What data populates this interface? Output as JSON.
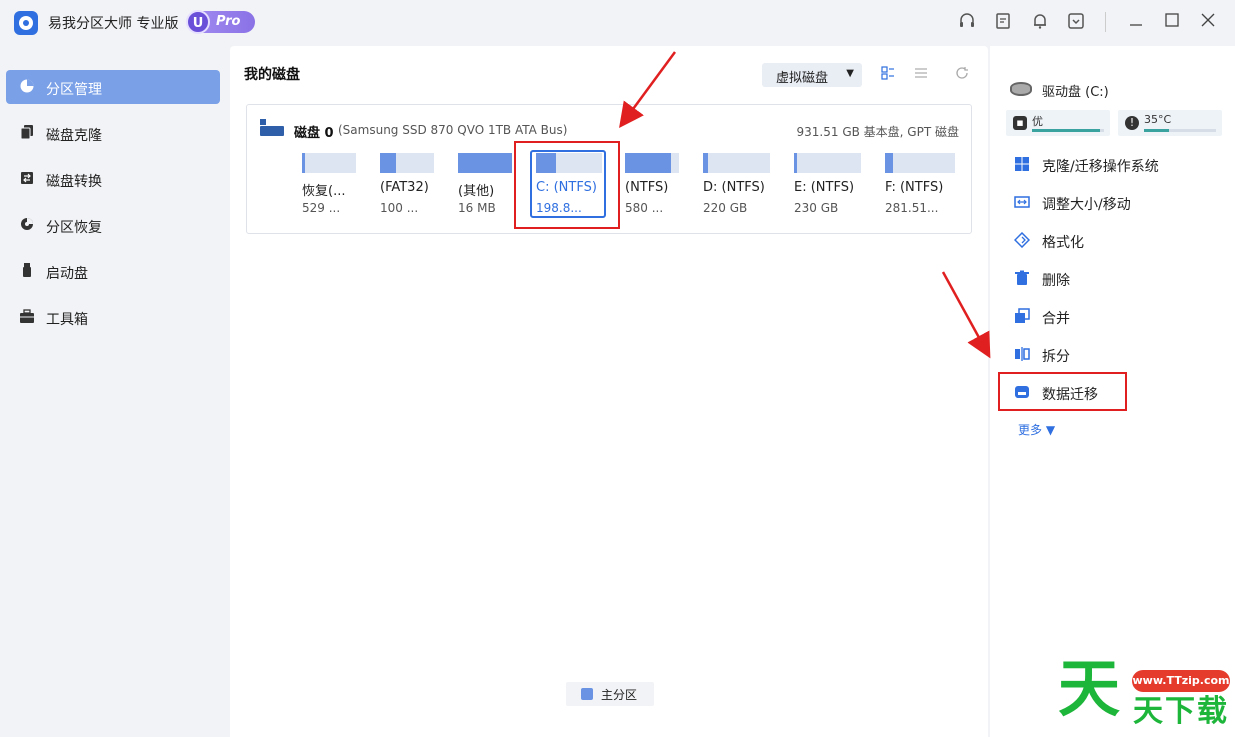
{
  "app": {
    "title": "易我分区大师 专业版",
    "badge_letter": "U",
    "badge_text": "Pro"
  },
  "titlebar_icons": [
    "headset-icon",
    "feedback-icon",
    "bell-icon",
    "download-icon"
  ],
  "sidebar": {
    "items": [
      {
        "label": "分区管理",
        "icon": "pie-chart-icon",
        "active": true
      },
      {
        "label": "磁盘克隆",
        "icon": "clone-icon",
        "active": false
      },
      {
        "label": "磁盘转换",
        "icon": "convert-icon",
        "active": false
      },
      {
        "label": "分区恢复",
        "icon": "recovery-icon",
        "active": false
      },
      {
        "label": "启动盘",
        "icon": "usb-icon",
        "active": false
      },
      {
        "label": "工具箱",
        "icon": "toolbox-icon",
        "active": false
      }
    ]
  },
  "main": {
    "title": "我的磁盘",
    "virtual_disk_label": "虚拟磁盘",
    "disk": {
      "name": "磁盘 0",
      "model": "(Samsung SSD 870 QVO 1TB ATA Bus)",
      "info": "931.51 GB 基本盘, GPT 磁盘",
      "partitions": [
        {
          "label": "恢复(...",
          "size": "529 ...",
          "fill": 0.05
        },
        {
          "label": "(FAT32)",
          "size": "100 ...",
          "fill": 0.3
        },
        {
          "label": "(其他)",
          "size": "16 MB",
          "fill": 1.0
        },
        {
          "label": "C: (NTFS)",
          "size": "198.8...",
          "fill": 0.3,
          "selected": true
        },
        {
          "label": "(NTFS)",
          "size": "580 ...",
          "fill": 0.85
        },
        {
          "label": "D: (NTFS)",
          "size": "220 GB",
          "fill": 0.08
        },
        {
          "label": "E: (NTFS)",
          "size": "230 GB",
          "fill": 0.05
        },
        {
          "label": "F: (NTFS)",
          "size": "281.51...",
          "fill": 0.12
        }
      ]
    },
    "legend": "主分区"
  },
  "right_panel": {
    "drive_label": "驱动盘 (C:)",
    "health_label": "优",
    "health_level": 0.95,
    "temp_label": "35°C",
    "temp_level": 0.35,
    "actions": [
      {
        "label": "克隆/迁移操作系统",
        "icon": "windows-icon"
      },
      {
        "label": "调整大小/移动",
        "icon": "resize-icon"
      },
      {
        "label": "格式化",
        "icon": "format-icon"
      },
      {
        "label": "删除",
        "icon": "trash-icon"
      },
      {
        "label": "合并",
        "icon": "merge-icon"
      },
      {
        "label": "拆分",
        "icon": "split-icon"
      },
      {
        "label": "数据迁移",
        "icon": "data-migrate-icon"
      }
    ],
    "more_label": "更多 ▼"
  },
  "watermark": {
    "big": "天",
    "url": "www.TTzip.com",
    "sub": "天下载"
  },
  "colors": {
    "accent": "#2f6fe0",
    "partition_fill": "#6b93e3",
    "partition_empty": "#dde5f3",
    "annotation_red": "#e02020",
    "sidebar_active": "#7aa0e8"
  }
}
